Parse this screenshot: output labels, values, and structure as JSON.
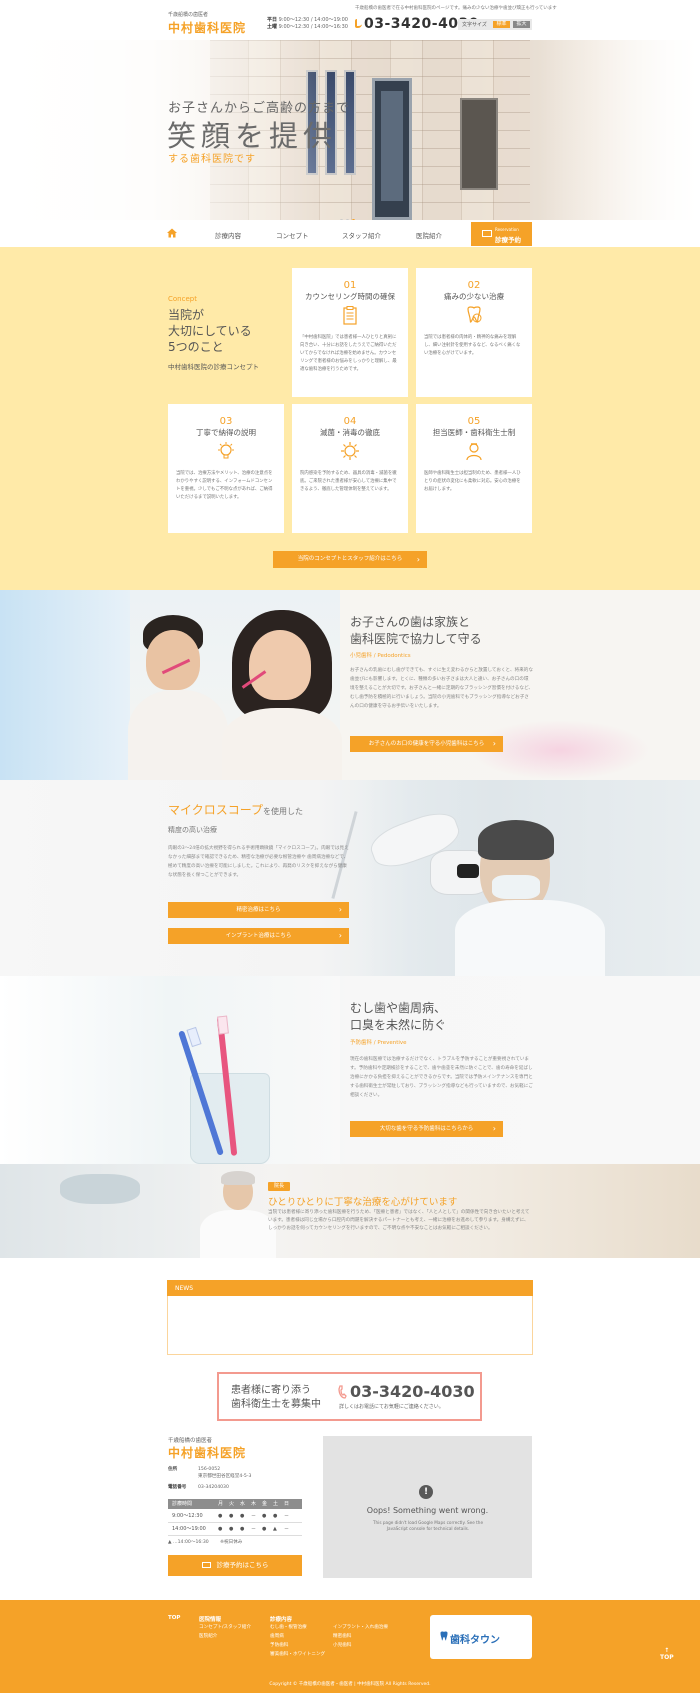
{
  "header": {
    "tagline": "千歳船橋の歯医者",
    "logo": "中村歯科医院",
    "top_note": "千歳船橋の歯医者で在る中村歯科医院のページです。痛みの少ない治療や歯並び矯正も行っています",
    "hours_weekday_label": "平日",
    "hours_weekday": "9:00～12:30 / 14:00～19:00",
    "hours_sat_label": "土曜",
    "hours_sat": "9:00～12:30 / 14:00～16:30",
    "phone": "03-3420-4030",
    "font_size_label": "文字サイズ",
    "font_std": "標準",
    "font_large": "拡大"
  },
  "hero": {
    "line1": "お子さんからご高齢の方まで",
    "line2": "笑顔を提供",
    "line3": "する歯科医院です"
  },
  "nav": {
    "items": [
      "診療内容",
      "コンセプト",
      "スタッフ紹介",
      "医院紹介"
    ],
    "cta_en": "Reservation",
    "cta_ja": "診療予約"
  },
  "concept": {
    "en": "Concept",
    "title1": "当院が",
    "title2": "大切にしている",
    "title3": "5つのこと",
    "subtitle": "中村歯科医院の診療コンセプト",
    "cards": [
      {
        "num": "01",
        "title": "カウンセリング時間の確保",
        "icon": "clipboard-icon",
        "text": "「中村歯科医院」では患者様一人ひとりと真剣に向き合い、十分にお話をしたうえでご納得いただいてからでなければ治療を始めません。カウンセリングで患者様のお悩みをしっかりと理解し、最適な歯科治療を行うためです。"
      },
      {
        "num": "02",
        "title": "痛みの少ない治療",
        "icon": "tooth-icon",
        "text": "当院では患者様の肉体的・精神的な痛みを理解し、細い注射針を使用するなど、なるべく痛くない治療を心がけています。"
      },
      {
        "num": "03",
        "title": "丁寧で納得の説明",
        "icon": "lightbulb-icon",
        "text": "当院では、治療方法やメリット、治療の注意点をわかりやすく説明する、インフォームドコンセントを重視。少しでもご不明な点があれば、ご納得いただけるまで説明いたします。"
      },
      {
        "num": "04",
        "title": "滅菌・消毒の徹底",
        "icon": "sterilize-icon",
        "text": "院内感染を予防するため、器具の消毒・滅菌を徹底。ご来院された患者様が安心して治療に集中できるよう、徹底した管理体制を整えています。"
      },
      {
        "num": "05",
        "title": "担当医師・歯科衛生士制",
        "icon": "doctor-icon",
        "text": "医師や歯科衛生士は担当制のため、患者様一人ひとりの症状の変化にも柔軟に対応。安心の治療をお届けします。"
      }
    ],
    "button": "当院のコンセプトとスタッフ紹介はこちら"
  },
  "kids": {
    "title1": "お子さんの歯は家族と",
    "title2": "歯科医院で協力して守る",
    "tag": "小児歯科 / Pedodontics",
    "body": "お子さんの乳歯にむし歯ができても、すぐに生え変わるからと放置しておくと、将来的な歯並びにも影響します。とくに、種類の多いお子さまは大人と違い、お子さんの口の環境を整えることが大切です。お子さんと一緒に定期的なブラッシング習慣を付けるなど、むし歯予防を積極的に行いましょう。当院の小児歯科でもブラッシング指導などお子さんの口の健康を守るお手伝いをいたします。",
    "button": "お子さんのお口の健康を守る小児歯科はこちら"
  },
  "micro": {
    "title_big": "マイクロスコープ",
    "title_small": "を使用した",
    "title2": "精度の高い治療",
    "body": "肉眼の3～24倍の拡大視野を得られる手術用顕微鏡「マイクロスコープ」。肉眼では見えなかった細部まで確認できるため、精密な治療が必要な根管治療や 歯周病治療などで、極めて精度の高い治療を可能にしました。これにより、再発のリスクを抑えながら健康な状態を長く保つことができます。",
    "btn1": "精密治療はこちら",
    "btn2": "インプラント治療はこちら"
  },
  "brush": {
    "title1": "むし歯や歯周病、",
    "title2": "口臭を未然に防ぐ",
    "tag": "予防歯科 / Preventive",
    "body": "現在の歯科医療では治療するだけでなく、トラブルを予防することが重要視されています。予防歯科や定期検診をすることで、歯や歯茎を未然に防ぐことで、歯の寿命を延ばし治療にかかる負担を抑えることができるからです。当院では予防メインテナンスを専門とする歯科衛生士が常駐しており、ブラッシング指導なども行っていますので、お気軽にご相談ください。",
    "button": "大切な歯を守る予防歯科はこちらから"
  },
  "doctor": {
    "badge": "院長",
    "title": "ひとりひとりに丁寧な治療を心がけています",
    "body": "当院では患者様に寄り添った歯科医療を行うため、「医療と患者」ではなく、「人と人として」の関係性で向き合いたいと考えています。患者様は同じ立場から口腔内の問題を解決するパートナーとも考え、一緒に治療をお進めして参ります。身構えずに、しっかりお話を伺ってカウンセリングを行いますので、ご不明な点や不安なことはお気軽にご相談ください。"
  },
  "news": {
    "heading": "NEWS"
  },
  "recruit": {
    "line1": "患者様に寄り添う",
    "line2": "歯科衛生士を募集中",
    "phone": "03-3420-4030",
    "note": "詳しくはお電話にてお気軽にご連絡ください。"
  },
  "info": {
    "tagline": "千歳船橋の歯医者",
    "logo": "中村歯科医院",
    "address_label": "住所",
    "zip": "156-0052",
    "address": "東京都世田谷区経堂4-5-3",
    "phone_label": "電話番号",
    "phone": "03-34204030",
    "table_header": [
      "診療時間",
      "月",
      "火",
      "水",
      "木",
      "金",
      "土",
      "日"
    ],
    "table_rows": [
      [
        "9:00～12:30",
        "●",
        "●",
        "●",
        "－",
        "●",
        "●",
        "－"
      ],
      [
        "14:00～19:00",
        "●",
        "●",
        "●",
        "－",
        "●",
        "▲",
        "－"
      ]
    ],
    "note_symbol": "▲",
    "note": "…14:00～16:30",
    "note_holiday": "※祝日休み",
    "reserve_btn": "診療予約はこちら"
  },
  "map": {
    "error_icon": "!",
    "error_title": "Oops! Something went wrong.",
    "error_text": "This page didn't load Google Maps correctly. See the JavaScript console for technical details."
  },
  "footer": {
    "top": "TOP",
    "col1_head": "医院情報",
    "col1": [
      "コンセプト/スタッフ紹介",
      "医院紹介"
    ],
    "col2_head": "診療内容",
    "col2": [
      "むし歯・根管治療",
      "歯周病",
      "予防歯科",
      "審美歯科・ホワイトニング"
    ],
    "col3": [
      "インプラント・入れ歯治療",
      "精密歯科",
      "小児歯科"
    ],
    "badge": "歯科タウン",
    "page_top": "TOP",
    "copyright": "Copyright © 千歳船橋の歯医者・歯医者 | 中村歯科医院 All Rights Reserved."
  },
  "colors": {
    "accent": "#f5a228",
    "concept_bg": "#ffeaa8",
    "recruit_border": "#f39a8f"
  }
}
